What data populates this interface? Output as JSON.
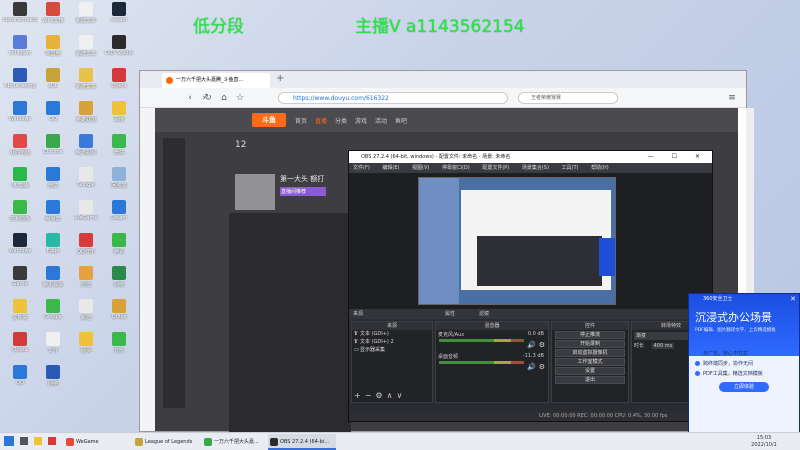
{
  "overlay": {
    "left_text": "低分段",
    "right_text": "主播V a1143562154"
  },
  "desktop_icons": [
    {
      "label": "hbvurwrmanb",
      "color": "#3a3a3a"
    },
    {
      "label": "WPS文档",
      "color": "#d94a3a"
    },
    {
      "label": "新建文本",
      "color": "#f0f0f0"
    },
    {
      "label": "Steam",
      "color": "#1b2838"
    },
    {
      "label": "setiigsay",
      "color": "#5b7bd8"
    },
    {
      "label": "中国电",
      "color": "#e8b23a"
    },
    {
      "label": "新建文本",
      "color": "#f0f0f0"
    },
    {
      "label": "OBS Studio",
      "color": "#2b2b2b"
    },
    {
      "label": "hbvuirwemg",
      "color": "#2b5ab8"
    },
    {
      "label": "LOL",
      "color": "#c8a23a"
    },
    {
      "label": "新建文本",
      "color": "#e8c34a"
    },
    {
      "label": "Opera",
      "color": "#d23a3a"
    },
    {
      "label": "Windows",
      "color": "#2a78d8"
    },
    {
      "label": "QQ",
      "color": "#2a78d8"
    },
    {
      "label": "英雄联盟",
      "color": "#d8a23a"
    },
    {
      "label": "百度",
      "color": "#f0c23a"
    },
    {
      "label": "我的电脑",
      "color": "#e24a4a"
    },
    {
      "label": "Chrome",
      "color": "#3aa84a"
    },
    {
      "label": "腾讯视频",
      "color": "#3a7ad8"
    },
    {
      "label": "微信",
      "color": "#3ab84a"
    },
    {
      "label": "UU加速",
      "color": "#2ab84a"
    },
    {
      "label": "微信",
      "color": "#2a78d8"
    },
    {
      "label": "Google",
      "color": "#e8e8e8"
    },
    {
      "label": "回收站",
      "color": "#8fb2d8"
    },
    {
      "label": "控制面板",
      "color": "#3ab84a"
    },
    {
      "label": "网易云",
      "color": "#2a78d8"
    },
    {
      "label": "WeGame",
      "color": "#e8e8e8"
    },
    {
      "label": "Steam",
      "color": "#2a78d8"
    },
    {
      "label": "Windows",
      "color": "#1b2838"
    },
    {
      "label": "Edge",
      "color": "#2ab8a8"
    },
    {
      "label": "QQ音乐",
      "color": "#d83a3a"
    },
    {
      "label": "腾讯",
      "color": "#3ab84a"
    },
    {
      "label": "Game",
      "color": "#3a3a3a"
    },
    {
      "label": "腾讯会议",
      "color": "#2a78d8"
    },
    {
      "label": "迅雷",
      "color": "#e8a23a"
    },
    {
      "label": "网络",
      "color": "#2a8a4a"
    },
    {
      "label": "文件夹",
      "color": "#f0c23a"
    },
    {
      "label": "Google",
      "color": "#3ab84a"
    },
    {
      "label": "新建",
      "color": "#e8e8e8"
    },
    {
      "label": "Office",
      "color": "#d8a23a"
    },
    {
      "label": "Opera",
      "color": "#d23a3a"
    },
    {
      "label": "文件",
      "color": "#f0f0f0"
    },
    {
      "label": "网页",
      "color": "#f0c23a"
    },
    {
      "label": "音乐",
      "color": "#3ab84a"
    },
    {
      "label": "QQ",
      "color": "#2a78d8"
    },
    {
      "label": "网络",
      "color": "#2a5ab8"
    }
  ],
  "browser": {
    "tab_title": "一万六千把大头嘉腾_斗鱼直...",
    "url": "https://www.douyu.com/616322",
    "search_placeholder": "王者荣耀猴赛",
    "logo": "斗鱼",
    "nav": [
      "首页",
      "直播",
      "分类",
      "游戏",
      "活动",
      "鱼吧"
    ],
    "stream_count": "12",
    "stream_title": "第一大头 额打",
    "stream_sub": "直播间推荐"
  },
  "obs": {
    "title": "OBS 27.2.4 (64-bit, windows) - 配置文件: 未命名 - 场景: 未命名",
    "menu": [
      "文件(F)",
      "编辑(E)",
      "视图(V)",
      "停靠窗口(D)",
      "配置文件(P)",
      "场景集合(S)",
      "工具(T)",
      "帮助(H)"
    ],
    "toolbar_left": "来源",
    "props_btn": "属性",
    "filter_btn": "滤镜",
    "scenes_header": "来源",
    "mixer_header": "混音器",
    "controls_header": "控件",
    "transition_header": "转场特效",
    "sources": [
      "文本 (GDI+)",
      "文本 (GDI+) 2",
      "显示器采集"
    ],
    "mixer": [
      {
        "name": "麦克风/Aux",
        "db": "0.0 dB"
      },
      {
        "name": "桌面音频",
        "db": "-11.3 dB"
      }
    ],
    "controls": [
      "停止推流",
      "开始录制",
      "启动虚拟摄像机",
      "工作室模式",
      "设置",
      "退出"
    ],
    "transition": {
      "name": "渐变",
      "duration_label": "时长",
      "duration": "400 ms"
    },
    "status": "LIVE: 00:00:00  REC: 00:00:00  CPU: 0.4%, 30.00 fps"
  },
  "ad": {
    "brand": "360安全卫士",
    "title": "沉浸式办公场景",
    "subtitle": "PDF编辑、图片翻译文字、上云精选模板",
    "features": [
      "无广告，安心不打扰",
      "跨终端同步，协作无间",
      "PDF工具集，精选文档模板"
    ],
    "button": "立即体验"
  },
  "taskbar": {
    "items": [
      {
        "label": "WeGame",
        "color": "#e84a3a"
      },
      {
        "label": "League of Legends",
        "color": "#c8a23a"
      },
      {
        "label": "一万六千把大头嘉...",
        "color": "#3aa84a"
      },
      {
        "label": "OBS 27.2.4 (64-bi...",
        "color": "#2b2b2b"
      }
    ],
    "time": "15:03",
    "date": "2022/10/1"
  }
}
